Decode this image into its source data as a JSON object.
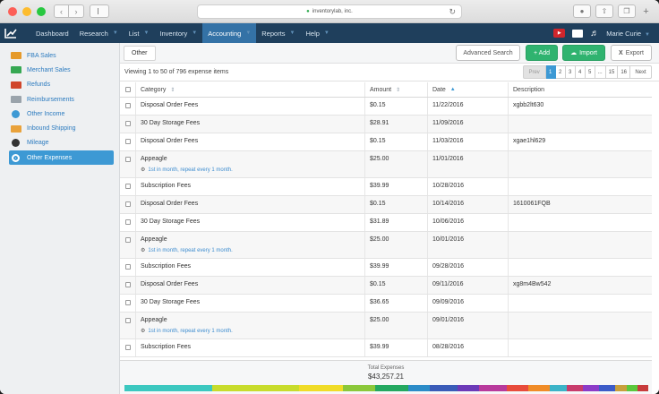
{
  "browser": {
    "url": "inventorylab, inc."
  },
  "nav": {
    "items": [
      {
        "label": "Dashboard",
        "caret": false,
        "active": false
      },
      {
        "label": "Research",
        "caret": true,
        "active": false
      },
      {
        "label": "List",
        "caret": true,
        "active": false
      },
      {
        "label": "Inventory",
        "caret": true,
        "active": false
      },
      {
        "label": "Accounting",
        "caret": true,
        "active": true
      },
      {
        "label": "Reports",
        "caret": true,
        "active": false
      },
      {
        "label": "Help",
        "caret": true,
        "active": false
      }
    ],
    "user": "Marie Curie"
  },
  "sidebar": {
    "items": [
      {
        "label": "FBA Sales",
        "color": "#e59a2b",
        "icon": "cash-icon"
      },
      {
        "label": "Merchant Sales",
        "color": "#36a853",
        "icon": "money-icon"
      },
      {
        "label": "Refunds",
        "color": "#d0452b",
        "icon": "refund-icon"
      },
      {
        "label": "Reimbursements",
        "color": "#9aa3ab",
        "icon": "receipt-icon"
      },
      {
        "label": "Other Income",
        "color": "#3d99d4",
        "icon": "coin-icon"
      },
      {
        "label": "Inbound Shipping",
        "color": "#e9a23b",
        "icon": "box-icon"
      },
      {
        "label": "Mileage",
        "color": "#333333",
        "icon": "wheel-icon"
      },
      {
        "label": "Other Expenses",
        "color": "#ffffff",
        "icon": "coin-icon",
        "active": true
      }
    ]
  },
  "toolbar": {
    "tab": "Other",
    "advanced_search": "Advanced Search",
    "add": "+ Add",
    "import": "Import",
    "export": "Export"
  },
  "info": {
    "viewing": "Viewing 1 to 50 of 796 expense items"
  },
  "pager": [
    "Prev",
    "1",
    "2",
    "3",
    "4",
    "5",
    "...",
    "15",
    "16",
    "Next"
  ],
  "table": {
    "headers": {
      "category": "Category",
      "amount": "Amount",
      "date": "Date",
      "description": "Description"
    },
    "rows": [
      {
        "category": "Disposal Order Fees",
        "amount": "$0.15",
        "date": "11/22/2016",
        "description": "xgbb2lt630",
        "repeat": ""
      },
      {
        "category": "30 Day Storage Fees",
        "amount": "$28.91",
        "date": "11/09/2016",
        "description": "",
        "repeat": ""
      },
      {
        "category": "Disposal Order Fees",
        "amount": "$0.15",
        "date": "11/03/2016",
        "description": "xgae1hl629",
        "repeat": ""
      },
      {
        "category": "Appeagle",
        "amount": "$25.00",
        "date": "11/01/2016",
        "description": "",
        "repeat": "1st in month, repeat every 1 month."
      },
      {
        "category": "Subscription Fees",
        "amount": "$39.99",
        "date": "10/28/2016",
        "description": "",
        "repeat": ""
      },
      {
        "category": "Disposal Order Fees",
        "amount": "$0.15",
        "date": "10/14/2016",
        "description": "1610061FQB",
        "repeat": ""
      },
      {
        "category": "30 Day Storage Fees",
        "amount": "$31.89",
        "date": "10/06/2016",
        "description": "",
        "repeat": ""
      },
      {
        "category": "Appeagle",
        "amount": "$25.00",
        "date": "10/01/2016",
        "description": "",
        "repeat": "1st in month, repeat every 1 month."
      },
      {
        "category": "Subscription Fees",
        "amount": "$39.99",
        "date": "09/28/2016",
        "description": "",
        "repeat": ""
      },
      {
        "category": "Disposal Order Fees",
        "amount": "$0.15",
        "date": "09/11/2016",
        "description": "xg8m4Bw542",
        "repeat": ""
      },
      {
        "category": "30 Day Storage Fees",
        "amount": "$36.65",
        "date": "09/09/2016",
        "description": "",
        "repeat": ""
      },
      {
        "category": "Appeagle",
        "amount": "$25.00",
        "date": "09/01/2016",
        "description": "",
        "repeat": "1st in month, repeat every 1 month."
      },
      {
        "category": "Subscription Fees",
        "amount": "$39.99",
        "date": "08/28/2016",
        "description": "",
        "repeat": ""
      }
    ]
  },
  "footer": {
    "total_label": "Total Expenses",
    "total_value": "$43,257.21",
    "bar_colors": [
      "#3cc8c0",
      "#c8dc2c",
      "#f0dc28",
      "#8bc83a",
      "#24a860",
      "#2c8cc8",
      "#3a5cb8",
      "#6c3ab8",
      "#b83a9c",
      "#e84c3c",
      "#f08c28",
      "#3cb4c8",
      "#c83c6c",
      "#8c3cc8",
      "#3c5cc8",
      "#c8a03c",
      "#5cc83c",
      "#c83c3c"
    ]
  }
}
